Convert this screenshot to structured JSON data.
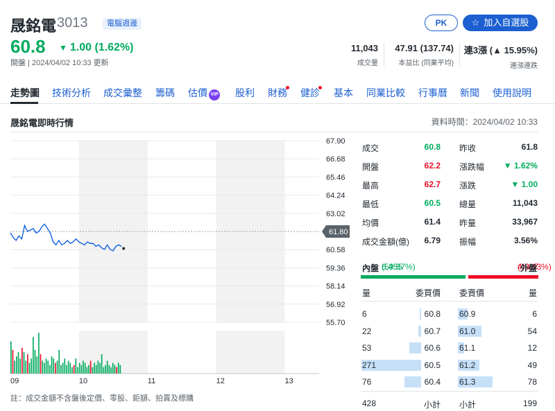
{
  "header": {
    "name": "晟銘電",
    "code": "3013",
    "tag": "電腦週邊",
    "price": "60.8",
    "change": "1.00 (1.62%)",
    "meta": "開盤 | 2024/04/02 10:33 更新",
    "pk_label": "PK",
    "add_label": "加入自選股",
    "stats": [
      {
        "value": "11,043",
        "label": "成交量"
      },
      {
        "value": "47.91 (137.74)",
        "label": "本益比 (同業平均)"
      },
      {
        "value": "連3漲 (▲ 15.95%)",
        "label": "連漲連跌"
      }
    ]
  },
  "nav": {
    "items": [
      "走勢圖",
      "技術分析",
      "成交彙整",
      "籌碼",
      "估價",
      "股利",
      "財務",
      "健診",
      "基本",
      "同業比較",
      "行事曆",
      "新聞",
      "使用說明"
    ],
    "vip": "VIP"
  },
  "section": {
    "title": "晟銘電即時行情",
    "time": "資料時間：2024/04/02 10:33"
  },
  "chart_data": {
    "type": "line",
    "y_ticks": [
      "67.90",
      "66.68",
      "65.46",
      "64.24",
      "63.02",
      "61.80",
      "60.58",
      "59.36",
      "58.14",
      "56.92",
      "55.70"
    ],
    "ylim": [
      55.7,
      67.9
    ],
    "reference_price": "61.80",
    "x_ticks": [
      "09",
      "10",
      "11",
      "12",
      "13"
    ],
    "price_series": [
      61.7,
      61.4,
      61.2,
      61.5,
      61.3,
      62.2,
      61.8,
      61.9,
      62.0,
      61.7,
      61.8,
      62.1,
      62.3,
      62.0,
      61.7,
      61.1,
      60.9,
      61.2,
      60.9,
      61.0,
      61.2,
      61.0,
      61.1,
      61.3,
      61.1,
      61.0,
      60.9,
      61.1,
      61.0,
      61.0,
      60.8,
      60.9,
      60.7,
      60.6,
      60.9,
      60.6,
      60.5,
      60.8,
      60.9,
      60.8
    ],
    "volume_series": [
      [
        0.75,
        0
      ],
      [
        0.55,
        1
      ],
      [
        0.3,
        0
      ],
      [
        0.4,
        0
      ],
      [
        0.5,
        0
      ],
      [
        0.35,
        0
      ],
      [
        0.6,
        1
      ],
      [
        0.5,
        0
      ],
      [
        0.3,
        0
      ],
      [
        0.45,
        1
      ],
      [
        0.25,
        0
      ],
      [
        0.35,
        0
      ],
      [
        0.85,
        0
      ],
      [
        0.55,
        0
      ],
      [
        0.4,
        0
      ],
      [
        0.95,
        0
      ],
      [
        0.45,
        1
      ],
      [
        0.3,
        0
      ],
      [
        0.25,
        0
      ],
      [
        0.35,
        0
      ],
      [
        0.3,
        0
      ],
      [
        0.2,
        0
      ],
      [
        0.4,
        0
      ],
      [
        0.35,
        0
      ],
      [
        0.25,
        1
      ],
      [
        0.3,
        0
      ],
      [
        0.55,
        0
      ],
      [
        0.2,
        0
      ],
      [
        0.25,
        0
      ],
      [
        0.35,
        0
      ],
      [
        0.2,
        0
      ],
      [
        0.3,
        0
      ],
      [
        0.25,
        0
      ],
      [
        0.15,
        0
      ],
      [
        0.2,
        1
      ],
      [
        0.35,
        0
      ],
      [
        0.15,
        0
      ],
      [
        0.25,
        0
      ],
      [
        0.2,
        0
      ],
      [
        0.3,
        0
      ],
      [
        0.25,
        0
      ],
      [
        0.15,
        0
      ],
      [
        0.2,
        0
      ],
      [
        0.3,
        1
      ],
      [
        0.15,
        0
      ],
      [
        0.25,
        0
      ],
      [
        0.2,
        0
      ],
      [
        0.3,
        0
      ],
      [
        0.25,
        0
      ],
      [
        0.45,
        0
      ],
      [
        0.15,
        0
      ],
      [
        0.2,
        0
      ],
      [
        0.3,
        0
      ],
      [
        0.2,
        0
      ],
      [
        0.15,
        0
      ],
      [
        0.25,
        0
      ],
      [
        0.2,
        0
      ],
      [
        0.15,
        1
      ],
      [
        0.25,
        0
      ],
      [
        0.2,
        0
      ]
    ],
    "colors": {
      "line": "#0055e0",
      "up": "#eb0f29",
      "down": "#00ab5e",
      "band": "#f2f2f2"
    }
  },
  "quote": {
    "rows": [
      {
        "l": "成交",
        "v": "60.8",
        "c": "green",
        "l2": "昨收",
        "v2": "61.8",
        "c2": ""
      },
      {
        "l": "開盤",
        "v": "62.2",
        "c": "red",
        "l2": "漲跌幅",
        "v2": "▼ 1.62%",
        "c2": "green"
      },
      {
        "l": "最高",
        "v": "62.7",
        "c": "red",
        "l2": "漲跌",
        "v2": "▼ 1.00",
        "c2": "green"
      },
      {
        "l": "最低",
        "v": "60.5",
        "c": "green",
        "l2": "總量",
        "v2": "11,043",
        "c2": ""
      },
      {
        "l": "均價",
        "v": "61.4",
        "c": "",
        "l2": "昨量",
        "v2": "33,967",
        "c2": ""
      },
      {
        "l": "成交金額(億)",
        "v": "6.79",
        "c": "",
        "l2": "振幅",
        "v2": "3.56%",
        "c2": ""
      }
    ]
  },
  "inout": {
    "in_label": "內盤",
    "in_value": "6,455",
    "in_pct": "(59.87%)",
    "out_value": "4,327",
    "out_pct": "(40.13%)",
    "out_label": "外盤",
    "in_ratio": 0.5987
  },
  "orderbook": {
    "headers": {
      "qty": "量",
      "bid": "委買價",
      "ask": "委賣價",
      "qty2": "量"
    },
    "rows": [
      {
        "bq": "6",
        "bp": "60.8",
        "bw": 0.02,
        "ap": "60.9",
        "aq": "6",
        "aw": 0.08
      },
      {
        "bq": "22",
        "bp": "60.7",
        "bw": 0.05,
        "ap": "61.0",
        "aq": "54",
        "aw": 0.2
      },
      {
        "bq": "53",
        "bp": "60.6",
        "bw": 0.2,
        "ap": "61.1",
        "aq": "12",
        "aw": 0.05
      },
      {
        "bq": "271",
        "bp": "60.5",
        "bw": 1.0,
        "ap": "61.2",
        "aq": "49",
        "aw": 0.18
      },
      {
        "bq": "76",
        "bp": "60.4",
        "bw": 0.28,
        "ap": "61.3",
        "aq": "78",
        "aw": 0.29
      }
    ],
    "footer": {
      "bid_total": "428",
      "bid_label": "小計",
      "ask_label": "小計",
      "ask_total": "199"
    }
  },
  "note": "註：成交金額不含盤後定價、零股、鉅額、拍賣及標購"
}
